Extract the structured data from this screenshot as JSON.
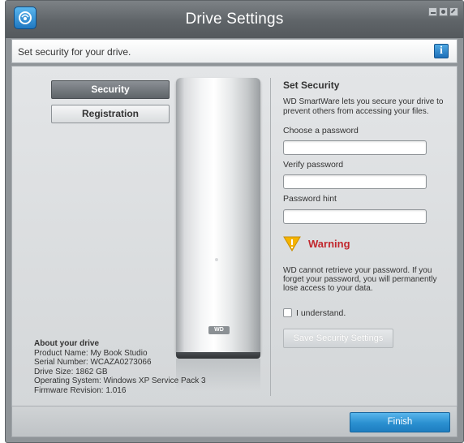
{
  "window": {
    "title": "Drive Settings"
  },
  "header": {
    "text": "Set security for your drive.",
    "info_label": "i"
  },
  "nav": {
    "items": [
      {
        "label": "Security",
        "active": true
      },
      {
        "label": "Registration",
        "active": false
      }
    ]
  },
  "drive_logo": "WD",
  "about": {
    "title": "About your drive",
    "product_name": "Product Name: My Book Studio",
    "serial_number": "Serial Number: WCAZA0273066",
    "drive_size": "Drive Size: 1862 GB",
    "os": "Operating System: Windows XP Service Pack 3",
    "firmware": "Firmware Revision: 1.016"
  },
  "security": {
    "title": "Set Security",
    "description": "WD SmartWare lets you secure your drive to prevent others from accessing your files.",
    "password_label": "Choose a password",
    "password_value": "",
    "verify_label": "Verify password",
    "verify_value": "",
    "hint_label": "Password hint",
    "hint_value": "",
    "warning_title": "Warning",
    "warning_text": "WD cannot retrieve your password. If you forget your password, you will permanently lose access to your data.",
    "understand_label": "I understand.",
    "understand_checked": false,
    "save_label": "Save Security Settings"
  },
  "footer": {
    "finish_label": "Finish"
  },
  "colors": {
    "accent": "#2a8fd0",
    "warning": "#c1272d",
    "warning_icon": "#f5b400"
  }
}
